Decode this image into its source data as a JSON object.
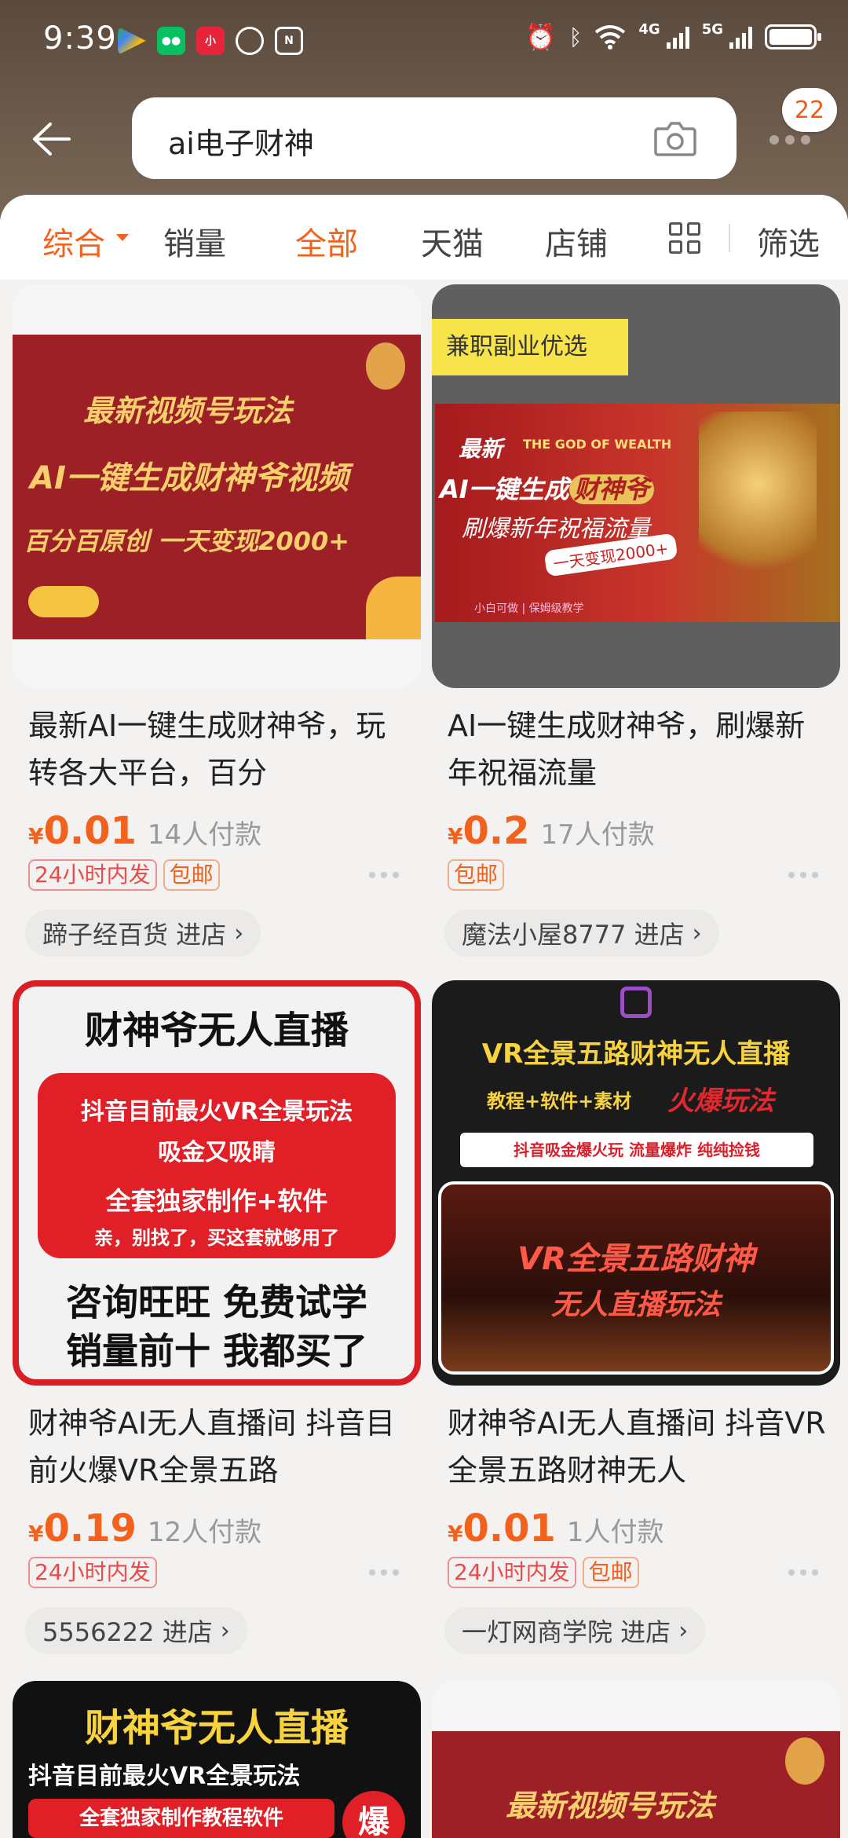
{
  "status_bar": {
    "time": "9:39",
    "network_4g": "4G",
    "network_5g": "5G"
  },
  "header": {
    "search_query": "ai电子财神",
    "message_count": "22"
  },
  "filters": [
    {
      "label": "综合",
      "active": true
    },
    {
      "label": "销量",
      "active": false
    },
    {
      "label": "全部",
      "active": true
    },
    {
      "label": "天猫",
      "active": false
    },
    {
      "label": "店铺",
      "active": false
    },
    {
      "label": "筛选",
      "active": false
    }
  ],
  "products": [
    {
      "image_text": {
        "l1": "最新视频号玩法",
        "l2": "AI一键生成财神爷视频",
        "l3": "百分百原创 一天变现2000+"
      },
      "title": "最新AI一键生成财神爷，玩转各大平台，百分",
      "currency": "¥",
      "price": "0.01",
      "sold": "14人付款",
      "tags": [
        "24小时内发",
        "包邮"
      ],
      "shop": "蹄子经百货 进店"
    },
    {
      "image_text": {
        "banner": "兼职副业优选",
        "god": "THE GOD OF WEALTH",
        "l1": "最新",
        "l2": "AI一键生成",
        "l2b": "财神爷",
        "l3": "刷爆新年祝福流量",
        "l4": "一天变现2000+",
        "foot": "小白可做 | 保姆级教学"
      },
      "title": "AI一键生成财神爷，刷爆新年祝福流量",
      "currency": "¥",
      "price": "0.2",
      "sold": "17人付款",
      "tags": [
        "包邮"
      ],
      "shop": "魔法小屋8777 进店"
    },
    {
      "image_text": {
        "l1": "财神爷无人直播",
        "l2": "抖音目前最火VR全景玩法",
        "l3": "吸金又吸睛",
        "l4": "全套独家制作+软件",
        "l5": "亲，别找了，买这套就够用了",
        "l6": "咨询旺旺 免费试学",
        "l7": "销量前十 我都买了"
      },
      "title": "财神爷AI无人直播间 抖音目前火爆VR全景五路",
      "currency": "¥",
      "price": "0.19",
      "sold": "12人付款",
      "tags": [
        "24小时内发"
      ],
      "shop": "5556222 进店"
    },
    {
      "image_text": {
        "l1": "VR全景五路财神无人直播",
        "l2": "教程+软件+素材",
        "l2b": "火爆玩法",
        "l3": "抖音吸金爆火玩 流量爆炸 纯纯捡钱",
        "l4": "VR全景五路财神",
        "l5": "无人直播玩法"
      },
      "title": "财神爷AI无人直播间 抖音VR全景五路财神无人",
      "currency": "¥",
      "price": "0.01",
      "sold": "1人付款",
      "tags": [
        "24小时内发",
        "包邮"
      ],
      "shop": "一灯网商学院 进店"
    },
    {
      "image_text": {
        "l1": "财神爷无人直播",
        "l2": "抖音目前最火VR全景玩法",
        "l3": "全套独家制作教程软件",
        "badge": "爆"
      }
    },
    {
      "image_text": {
        "l1": "最新视频号玩法"
      }
    }
  ]
}
